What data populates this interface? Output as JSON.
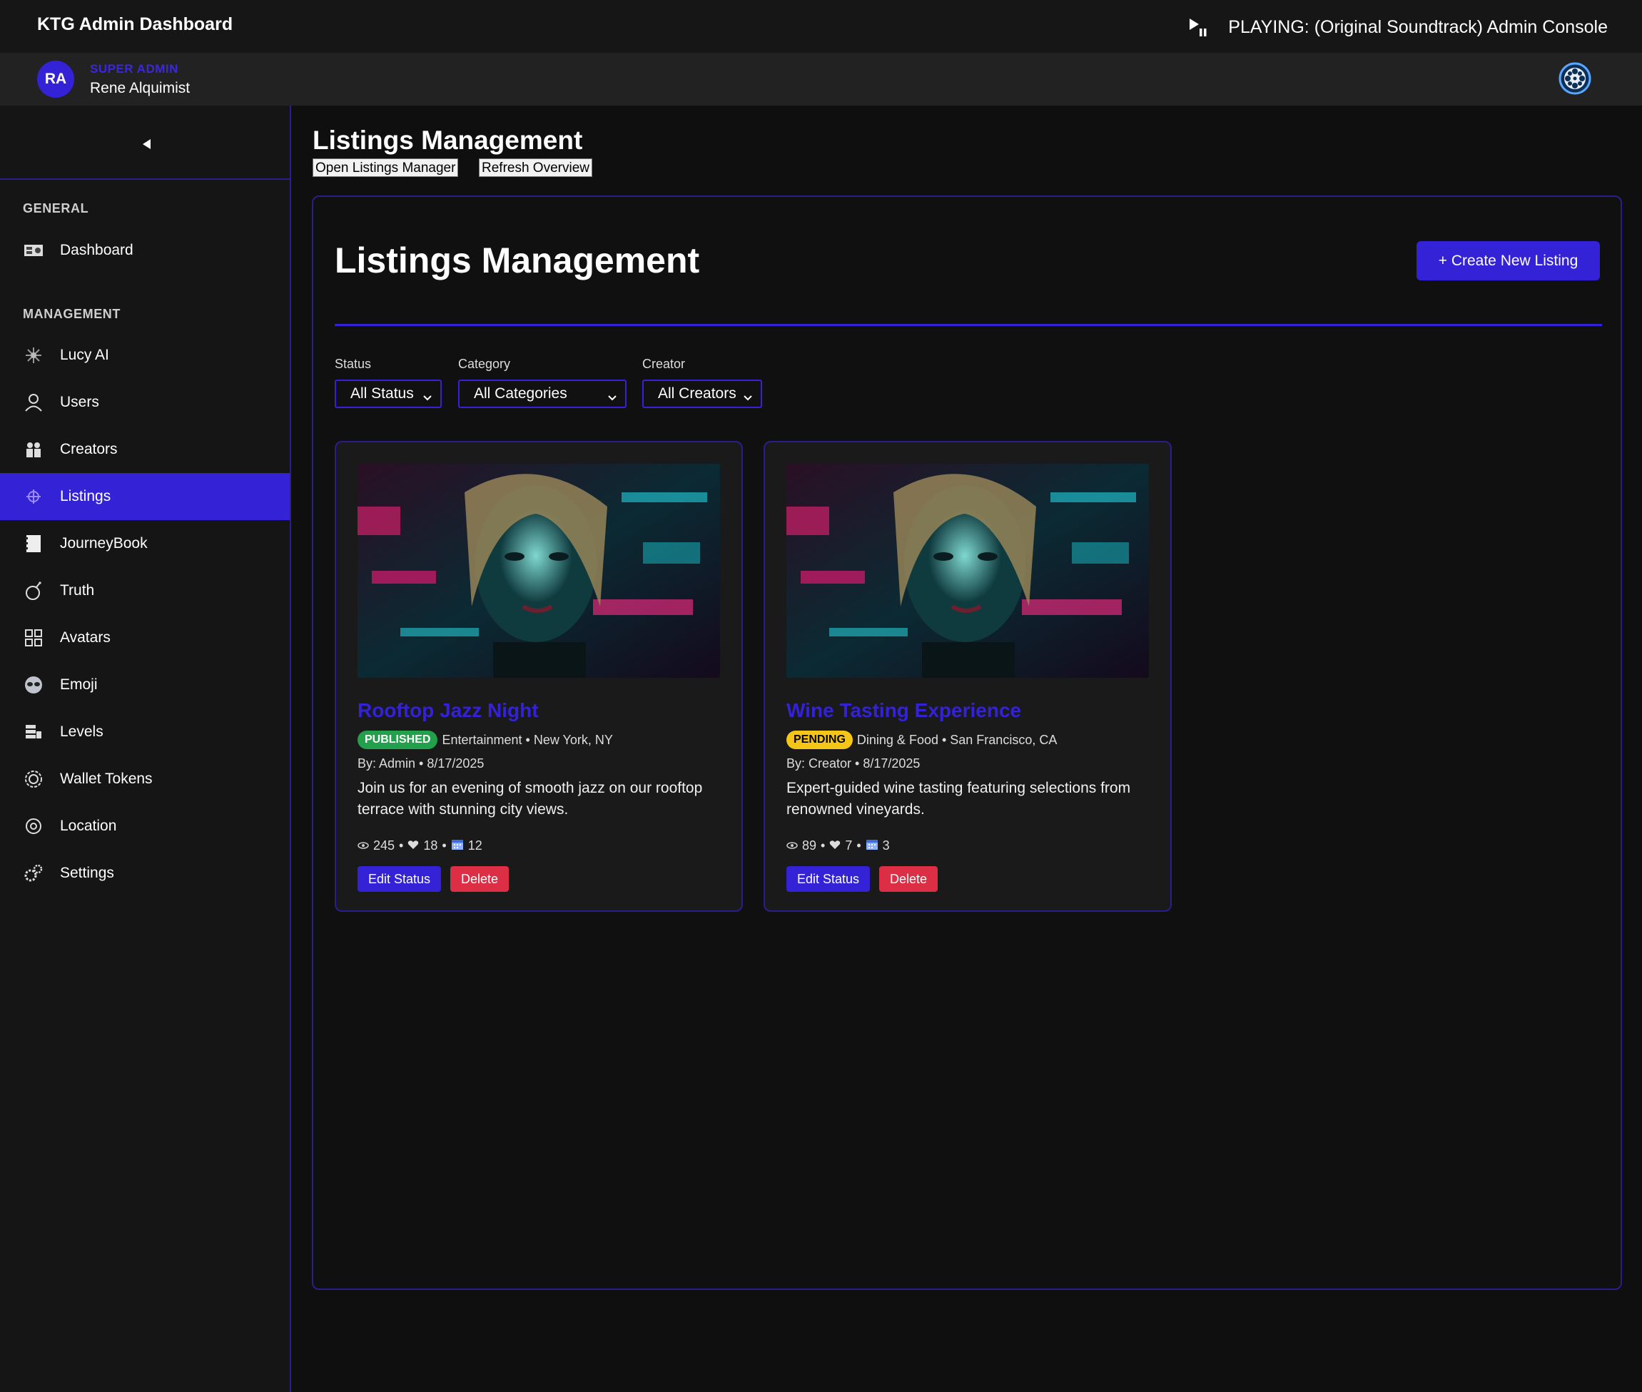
{
  "app": {
    "title": "KTG Admin Dashboard"
  },
  "player": {
    "now_playing": "PLAYING: (Original Soundtrack) Admin Console",
    "icon": "play-pause-icon"
  },
  "user": {
    "initials": "RA",
    "role": "SUPER ADMIN",
    "name": "Rene Alquimist"
  },
  "sidebar": {
    "general_label": "GENERAL",
    "management_label": "MANAGEMENT",
    "items": [
      {
        "label": "Dashboard",
        "icon": "dashboard-icon"
      },
      {
        "label": "Lucy AI",
        "icon": "sparkle-icon"
      },
      {
        "label": "Users",
        "icon": "user-icon"
      },
      {
        "label": "Creators",
        "icon": "people-icon"
      },
      {
        "label": "Listings",
        "icon": "target-icon",
        "active": true
      },
      {
        "label": "JourneyBook",
        "icon": "book-icon"
      },
      {
        "label": "Truth",
        "icon": "bomb-icon"
      },
      {
        "label": "Avatars",
        "icon": "grid-icon"
      },
      {
        "label": "Emoji",
        "icon": "alien-icon"
      },
      {
        "label": "Levels",
        "icon": "stack-icon"
      },
      {
        "label": "Wallet Tokens",
        "icon": "gear-token-icon"
      },
      {
        "label": "Location",
        "icon": "location-icon"
      },
      {
        "label": "Settings",
        "icon": "gears-icon"
      }
    ]
  },
  "page": {
    "title": "Listings Management",
    "open_manager_label": "Open Listings Manager",
    "refresh_label": "Refresh Overview"
  },
  "panel": {
    "title": "Listings Management",
    "create_label": "+ Create New Listing",
    "filters": {
      "status_label": "Status",
      "status_value": "All Status",
      "category_label": "Category",
      "category_value": "All Categories",
      "creator_label": "Creator",
      "creator_value": "All Creators"
    }
  },
  "listings": [
    {
      "title": "Rooftop Jazz Night",
      "status": "PUBLISHED",
      "category_location": "Entertainment • New York, NY",
      "by": "By: Admin • 8/17/2025",
      "description": "Join us for an evening of smooth jazz on our rooftop terrace with stunning city views.",
      "views": "245",
      "likes": "18",
      "bookings": "12",
      "edit_label": "Edit Status",
      "delete_label": "Delete"
    },
    {
      "title": "Wine Tasting Experience",
      "status": "PENDING",
      "category_location": "Dining & Food • San Francisco, CA",
      "by": "By: Creator • 8/17/2025",
      "description": "Expert-guided wine tasting featuring selections from renowned vineyards.",
      "views": "89",
      "likes": "7",
      "bookings": "3",
      "edit_label": "Edit Status",
      "delete_label": "Delete"
    }
  ],
  "colors": {
    "accent": "#3422d6",
    "published": "#22a04b",
    "pending": "#f5c518",
    "danger": "#dc2f45"
  }
}
